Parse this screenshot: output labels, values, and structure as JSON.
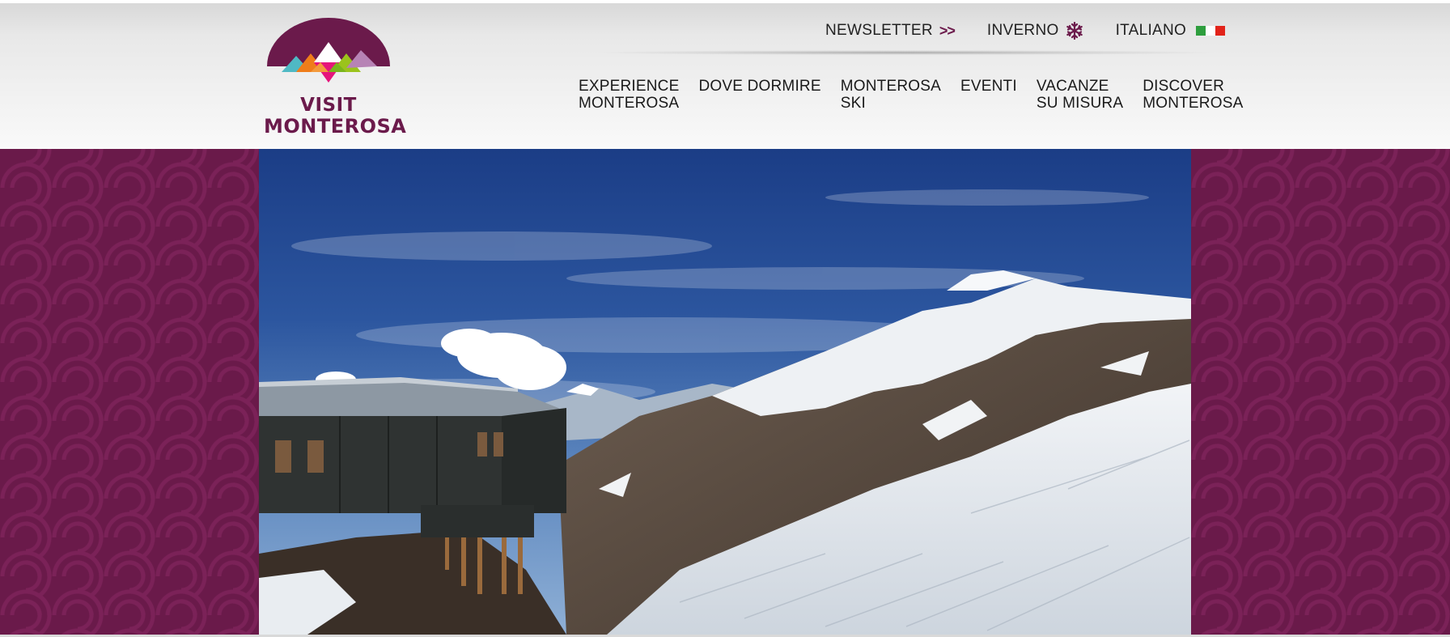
{
  "logo": {
    "line1": "VISIT",
    "line2": "MONTEROSA",
    "colors": {
      "brand": "#6b1a4b",
      "teal": "#4fb9c4",
      "orange": "#ef7d1a",
      "white": "#ffffff",
      "green": "#9bc31c",
      "pink": "#e5157b",
      "lilac": "#b783b5"
    }
  },
  "utility_nav": {
    "newsletter": "NEWSLETTER",
    "newsletter_icon": ">>",
    "inverno": "INVERNO",
    "inverno_icon": "snowflake-icon",
    "language": "ITALIANO",
    "language_icon": "italian-flag-icon"
  },
  "main_nav": [
    {
      "label": "EXPERIENCE\nMONTEROSA"
    },
    {
      "label": "DOVE DORMIRE"
    },
    {
      "label": "MONTEROSA\nSKI"
    },
    {
      "label": "EVENTI"
    },
    {
      "label": "VACANZE\nSU MISURA"
    },
    {
      "label": "DISCOVER\nMONTEROSA"
    }
  ],
  "colors": {
    "brand": "#6b1a4b",
    "pattern": "#7b2258",
    "header_bg": "#e8e8e8"
  }
}
